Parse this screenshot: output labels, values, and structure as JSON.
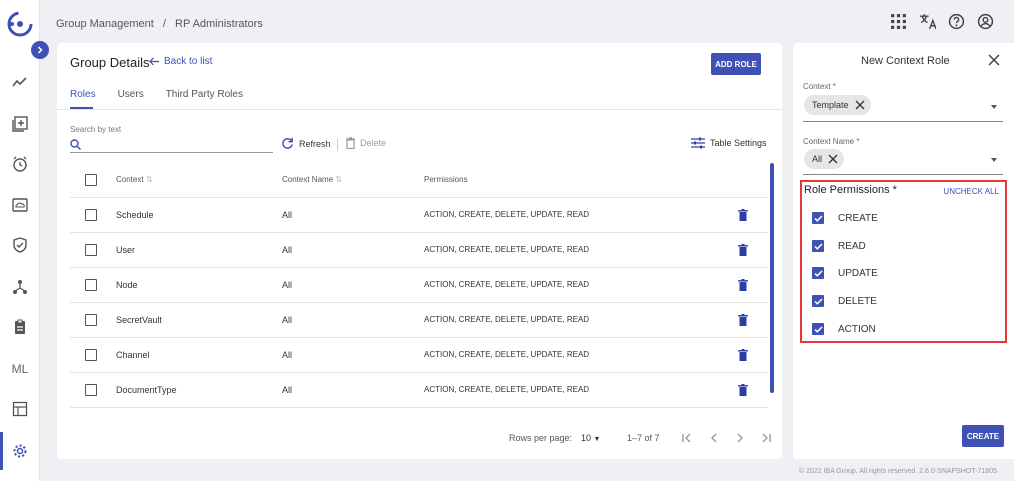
{
  "breadcrumb": [
    "Group Management",
    "/",
    "RP Administrators"
  ],
  "card": {
    "title": "Group Details",
    "back_label": "Back to list",
    "add_role_label": "ADD ROLE",
    "tabs": [
      "Roles",
      "Users",
      "Third Party Roles"
    ],
    "search_label": "Search by text",
    "refresh_label": "Refresh",
    "delete_label": "Delete",
    "table_settings_label": "Table Settings",
    "columns": [
      "Context",
      "Context Name",
      "Permissions"
    ],
    "rows": [
      {
        "context": "Schedule",
        "name": "All",
        "perms": "ACTION, CREATE, DELETE, UPDATE, READ"
      },
      {
        "context": "User",
        "name": "All",
        "perms": "ACTION, CREATE, DELETE, UPDATE, READ"
      },
      {
        "context": "Node",
        "name": "All",
        "perms": "ACTION, CREATE, DELETE, UPDATE, READ"
      },
      {
        "context": "SecretVault",
        "name": "All",
        "perms": "ACTION, CREATE, DELETE, UPDATE, READ"
      },
      {
        "context": "Channel",
        "name": "All",
        "perms": "ACTION, CREATE, DELETE, UPDATE, READ"
      },
      {
        "context": "DocumentType",
        "name": "All",
        "perms": "ACTION, CREATE, DELETE, UPDATE, READ"
      }
    ],
    "rows_per_page_label": "Rows per page:",
    "rows_per_page_value": "10",
    "range_label": "1–7 of 7"
  },
  "panel": {
    "title": "New Context Role",
    "context_label": "Context *",
    "context_chip": "Template",
    "context_name_label": "Context Name *",
    "context_name_chip": "All",
    "permissions_title": "Role Permissions *",
    "uncheck_label": "UNCHECK ALL",
    "permissions": [
      "CREATE",
      "READ",
      "UPDATE",
      "DELETE",
      "ACTION"
    ],
    "create_label": "CREATE"
  },
  "nav": {
    "ml_label": "ML"
  },
  "footer": "© 2022 IBA Group. All rights reserved. 2.6.0-SNAPSHOT-71805",
  "colors": {
    "accent": "#3f51b5",
    "highlight": "#e53935"
  }
}
